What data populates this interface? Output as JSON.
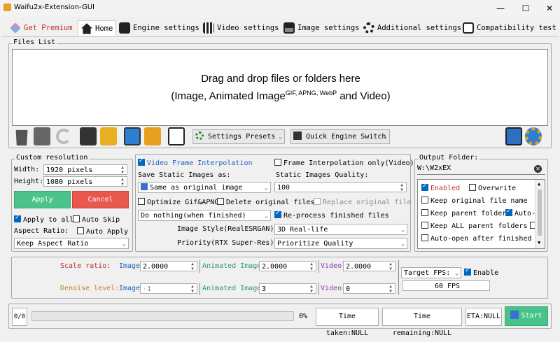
{
  "window": {
    "title": "Waifu2x-Extension-GUI",
    "minimize": "—",
    "maximize": "☐",
    "close": "✕"
  },
  "tabs": [
    {
      "label": "Get Premium",
      "color": "#d23030"
    },
    {
      "label": "Home"
    },
    {
      "label": "Engine settings"
    },
    {
      "label": "Video settings"
    },
    {
      "label": "Image settings"
    },
    {
      "label": "Additional settings"
    },
    {
      "label": "Compatibility test"
    }
  ],
  "files_list": {
    "legend": "Files List",
    "drop_line1": "Drag and drop files or folders here",
    "drop_line2_a": "(Image, Animated Image",
    "drop_line2_sup": "GIF, APNG, WebP",
    "drop_line2_b": " and Video)"
  },
  "toolbar": {
    "settings_presets": "Settings Presets",
    "quick_engine_switch": "Quick Engine Switch"
  },
  "custom_resolution": {
    "legend": "Custom resolution",
    "width_label": "Width:",
    "width_value": "1920 pixels",
    "height_label": "Height:",
    "height_value": "1080 pixels",
    "apply": "Apply",
    "cancel": "Cancel",
    "apply_to_all": "Apply to all",
    "auto_skip": "Auto Skip",
    "aspect_ratio_label": "Aspect Ratio:",
    "auto_apply": "Auto Apply",
    "aspect_ratio_value": "Keep Aspect Ratio"
  },
  "middle": {
    "video_frame_interp": "Video Frame Interpolation",
    "frame_interp_only": "Frame Interpolation only(Video)",
    "save_static_as": "Save Static Images as:",
    "static_quality": "Static Images Quality:",
    "save_format": "Same as original image",
    "quality_value": "100",
    "optimize_gif": "Optimize Gif&APNG",
    "delete_original": "Delete original files",
    "replace_original": "Replace original file",
    "after_finish": "Do nothing(when finished)",
    "reprocess": "Re-process finished files",
    "image_style_label": "Image Style(RealESRGAN):",
    "image_style_value": "3D Real-life",
    "priority_label": "Priority(RTX Super-Res):",
    "priority_value": "Prioritize Quality"
  },
  "output": {
    "legend": "Output Folder:",
    "path": "W:\\W2xEX",
    "enabled": "Enabled",
    "overwrite": "Overwrite",
    "keep_name": "Keep original file name",
    "keep_parent": "Keep parent folder",
    "auto_c": "Auto-C",
    "keep_all_parent": "Keep ALL parent folders",
    "auto_open": "Auto-open after finished"
  },
  "scale": {
    "scale_ratio": "Scale ratio:",
    "denoise_level": "Denoise level:",
    "image": "Image",
    "animated_image": "Animated Image",
    "video": "Video",
    "scale_image": "2.0000",
    "scale_anim": "2.0000",
    "scale_video": "2.0000",
    "denoise_image": "-1",
    "denoise_anim": "3",
    "denoise_video": "0",
    "target_fps": "Target FPS:",
    "enable": "Enable",
    "fps_value": "60 FPS"
  },
  "status": {
    "count": "0/0",
    "percent": "0%",
    "time_taken": "Time taken:NULL",
    "time_remaining": "Time remaining:NULL",
    "eta": "ETA:NULL",
    "start": "Start",
    "progress": 0
  }
}
